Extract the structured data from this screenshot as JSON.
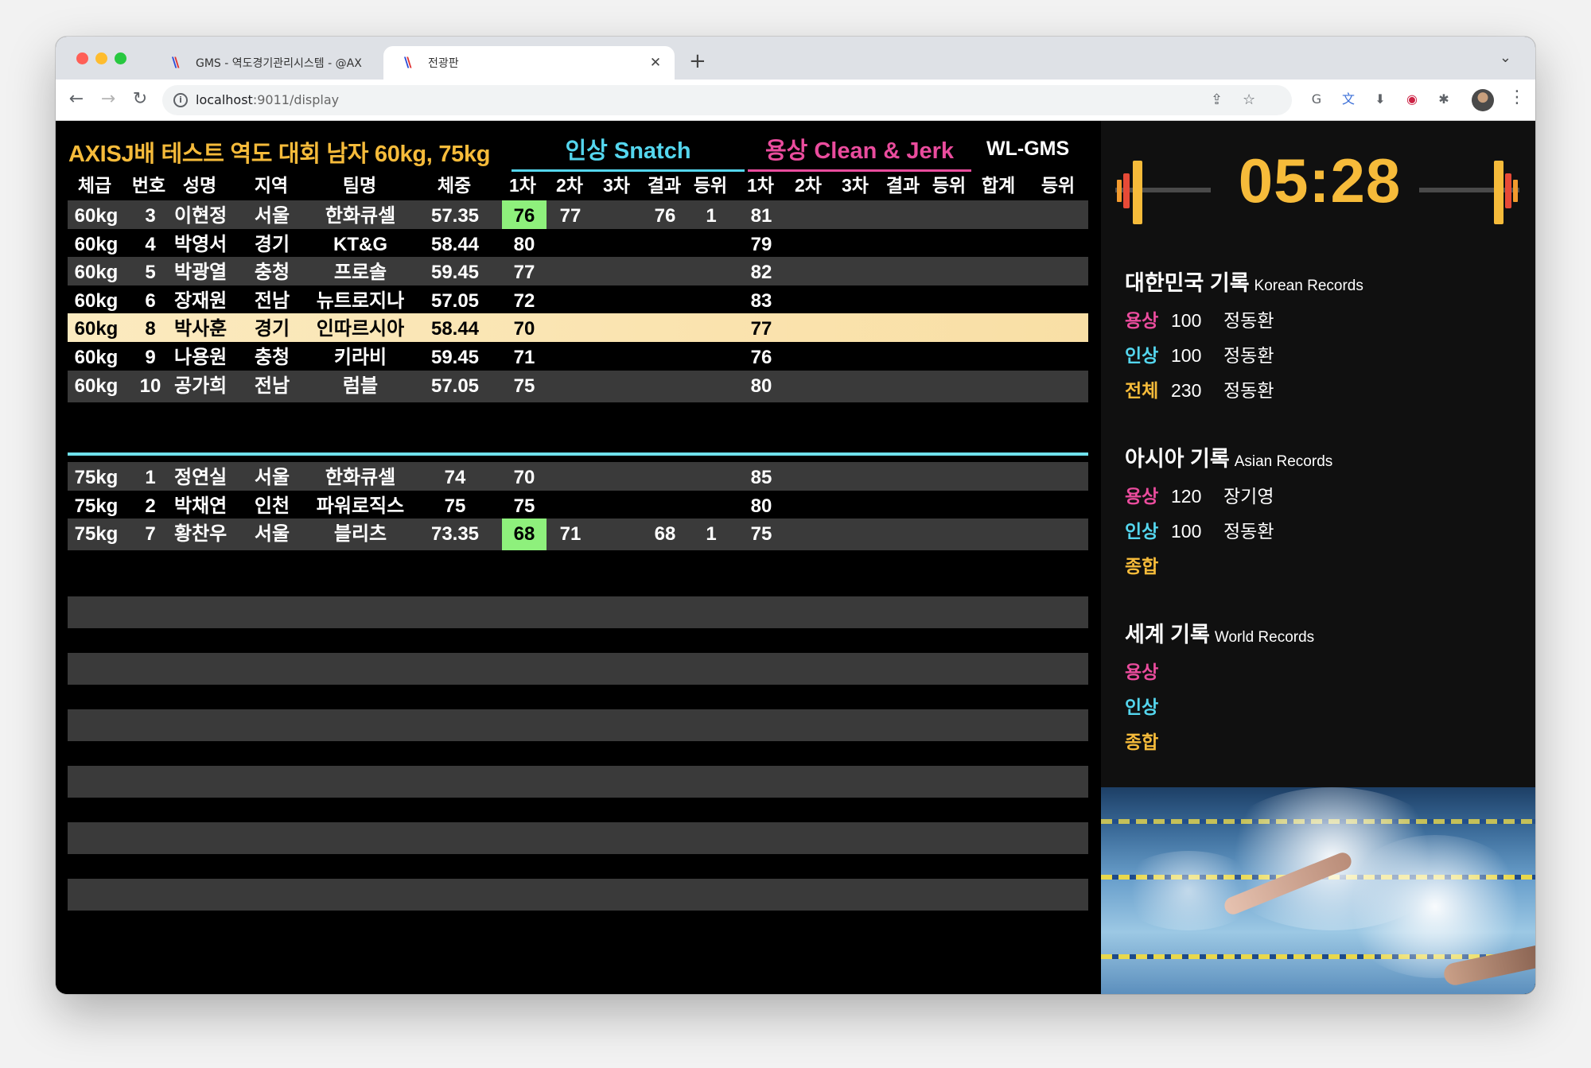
{
  "browser": {
    "tabs": [
      {
        "title": "GMS - 역도경기관리시스템 - @AX",
        "active": false
      },
      {
        "title": "전광판",
        "active": true
      }
    ],
    "url_host": "localhost",
    "url_path": ":9011/display"
  },
  "display": {
    "title": "AXISJ배 테스트 역도 대회 남자 60kg, 75kg",
    "snatch_title": "인상 Snatch",
    "cj_title": "용상 Clean & Jerk",
    "brand": "WL-GMS",
    "columns": {
      "weight_class": "체급",
      "number": "번호",
      "name": "성명",
      "region": "지역",
      "team": "팀명",
      "bodyweight": "체중",
      "sn1": "1차",
      "sn2": "2차",
      "sn3": "3차",
      "sn_result": "결과",
      "sn_rank": "등위",
      "cj1": "1차",
      "cj2": "2차",
      "cj3": "3차",
      "cj_result": "결과",
      "cj_rank": "등위",
      "total": "합계",
      "rank": "등위"
    },
    "group_60": [
      {
        "wc": "60kg",
        "no": "3",
        "name": "이현정",
        "region": "서울",
        "team": "한화큐셀",
        "bw": "57.35",
        "sn1": "76",
        "sn2": "77",
        "sn3": "",
        "snr": "76",
        "snk": "1",
        "cj1": "81"
      },
      {
        "wc": "60kg",
        "no": "4",
        "name": "박영서",
        "region": "경기",
        "team": "KT&G",
        "bw": "58.44",
        "sn1": "80",
        "sn2": "",
        "sn3": "",
        "snr": "",
        "snk": "",
        "cj1": "79"
      },
      {
        "wc": "60kg",
        "no": "5",
        "name": "박광열",
        "region": "충청",
        "team": "프로솔",
        "bw": "59.45",
        "sn1": "77",
        "sn2": "",
        "sn3": "",
        "snr": "",
        "snk": "",
        "cj1": "82"
      },
      {
        "wc": "60kg",
        "no": "6",
        "name": "장재원",
        "region": "전남",
        "team": "뉴트로지나",
        "bw": "57.05",
        "sn1": "72",
        "sn2": "",
        "sn3": "",
        "snr": "",
        "snk": "",
        "cj1": "83"
      },
      {
        "wc": "60kg",
        "no": "8",
        "name": "박사훈",
        "region": "경기",
        "team": "인따르시아",
        "bw": "58.44",
        "sn1": "70",
        "sn2": "",
        "sn3": "",
        "snr": "",
        "snk": "",
        "cj1": "77"
      },
      {
        "wc": "60kg",
        "no": "9",
        "name": "나용원",
        "region": "충청",
        "team": "키라비",
        "bw": "59.45",
        "sn1": "71",
        "sn2": "",
        "sn3": "",
        "snr": "",
        "snk": "",
        "cj1": "76"
      },
      {
        "wc": "60kg",
        "no": "10",
        "name": "공가희",
        "region": "전남",
        "team": "럼블",
        "bw": "57.05",
        "sn1": "75",
        "sn2": "",
        "sn3": "",
        "snr": "",
        "snk": "",
        "cj1": "80"
      }
    ],
    "group_75": [
      {
        "wc": "75kg",
        "no": "1",
        "name": "정연실",
        "region": "서울",
        "team": "한화큐셀",
        "bw": "74",
        "sn1": "70",
        "sn2": "",
        "sn3": "",
        "snr": "",
        "snk": "",
        "cj1": "85"
      },
      {
        "wc": "75kg",
        "no": "2",
        "name": "박채연",
        "region": "인천",
        "team": "파워로직스",
        "bw": "75",
        "sn1": "75",
        "sn2": "",
        "sn3": "",
        "snr": "",
        "snk": "",
        "cj1": "80"
      },
      {
        "wc": "75kg",
        "no": "7",
        "name": "황찬우",
        "region": "서울",
        "team": "블리츠",
        "bw": "73.35",
        "sn1": "68",
        "sn2": "71",
        "sn3": "",
        "snr": "68",
        "snk": "1",
        "cj1": "75"
      }
    ]
  },
  "side": {
    "timer": "05:28",
    "korean": {
      "title": "대한민국 기록",
      "sub": "Korean Records",
      "rows": [
        {
          "label": "용상",
          "value": "100",
          "holder": "정동환"
        },
        {
          "label": "인상",
          "value": "100",
          "holder": "정동환"
        },
        {
          "label": "전체",
          "value": "230",
          "holder": "정동환"
        }
      ]
    },
    "asian": {
      "title": "아시아 기록",
      "sub": "Asian Records",
      "rows": [
        {
          "label": "용상",
          "value": "120",
          "holder": "장기영"
        },
        {
          "label": "인상",
          "value": "100",
          "holder": "정동환"
        },
        {
          "label": "종합",
          "value": "",
          "holder": ""
        }
      ]
    },
    "world": {
      "title": "세계 기록",
      "sub": "World Records",
      "rows": [
        {
          "label": "용상",
          "value": "",
          "holder": ""
        },
        {
          "label": "인상",
          "value": "",
          "holder": ""
        },
        {
          "label": "종합",
          "value": "",
          "holder": ""
        }
      ]
    }
  },
  "colors": {
    "gold": "#f6bb3a",
    "cyan": "#54d6ee",
    "pink": "#ea4c9d",
    "success_green": "#8ef07c",
    "highlight": "#fbeabf"
  }
}
